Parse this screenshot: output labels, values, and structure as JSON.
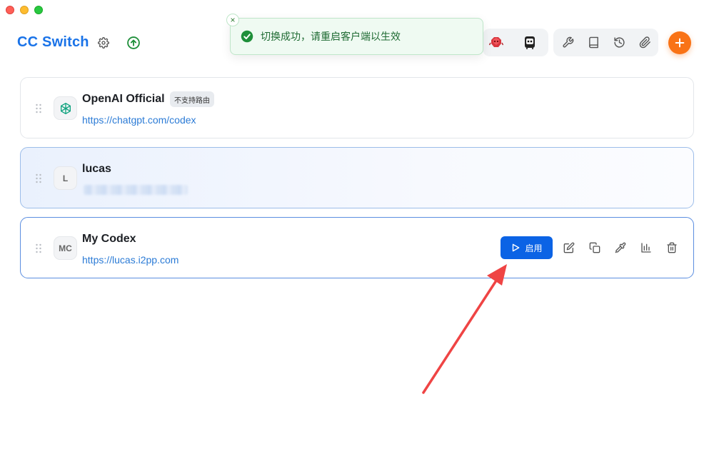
{
  "app": {
    "title": "CC Switch"
  },
  "toast": {
    "message": "切换成功，请重启客户端以生效",
    "close_icon": "×"
  },
  "header": {
    "icons": [
      "gear-icon",
      "upload-arrow-icon",
      "red-mascot-icon",
      "dark-mascot-icon",
      "wrench-icon",
      "book-icon",
      "history-icon",
      "paperclip-icon",
      "plus-icon"
    ]
  },
  "providers": [
    {
      "name": "OpenAI Official",
      "badge": "不支持路由",
      "url": "https://chatgpt.com/codex",
      "avatar_icon": "openai-logo-icon"
    },
    {
      "name": "lucas",
      "avatar_letter": "L",
      "url_obscured": true
    },
    {
      "name": "My Codex",
      "avatar_letter": "MC",
      "url": "https://lucas.i2pp.com",
      "enable_label": "启用"
    }
  ],
  "colors": {
    "brand": "#1a73e8",
    "accent_orange": "#f97316",
    "primary_button": "#0b63e5",
    "success_green": "#1f8f3a",
    "link": "#2b7bd6",
    "annotation_arrow": "#ef4444"
  }
}
